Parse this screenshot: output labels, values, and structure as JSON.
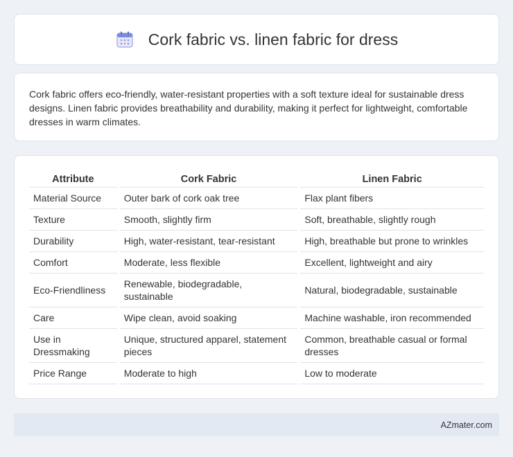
{
  "header": {
    "title": "Cork fabric vs. linen fabric for dress",
    "icon": "calendar-icon"
  },
  "intro": {
    "text": "Cork fabric offers eco-friendly, water-resistant properties with a soft texture ideal for sustainable dress designs. Linen fabric provides breathability and durability, making it perfect for lightweight, comfortable dresses in warm climates."
  },
  "table": {
    "headers": [
      "Attribute",
      "Cork Fabric",
      "Linen Fabric"
    ],
    "rows": [
      [
        "Material Source",
        "Outer bark of cork oak tree",
        "Flax plant fibers"
      ],
      [
        "Texture",
        "Smooth, slightly firm",
        "Soft, breathable, slightly rough"
      ],
      [
        "Durability",
        "High, water-resistant, tear-resistant",
        "High, breathable but prone to wrinkles"
      ],
      [
        "Comfort",
        "Moderate, less flexible",
        "Excellent, lightweight and airy"
      ],
      [
        "Eco-Friendliness",
        "Renewable, biodegradable, sustainable",
        "Natural, biodegradable, sustainable"
      ],
      [
        "Care",
        "Wipe clean, avoid soaking",
        "Machine washable, iron recommended"
      ],
      [
        "Use in Dressmaking",
        "Unique, structured apparel, statement pieces",
        "Common, breathable casual or formal dresses"
      ],
      [
        "Price Range",
        "Moderate to high",
        "Low to moderate"
      ]
    ]
  },
  "footer": {
    "text": "AZmater.com"
  },
  "colors": {
    "background": "#eef2f7",
    "card": "#ffffff",
    "footer_bg": "#e3e9f3",
    "icon_accent": "#7b8cde"
  }
}
